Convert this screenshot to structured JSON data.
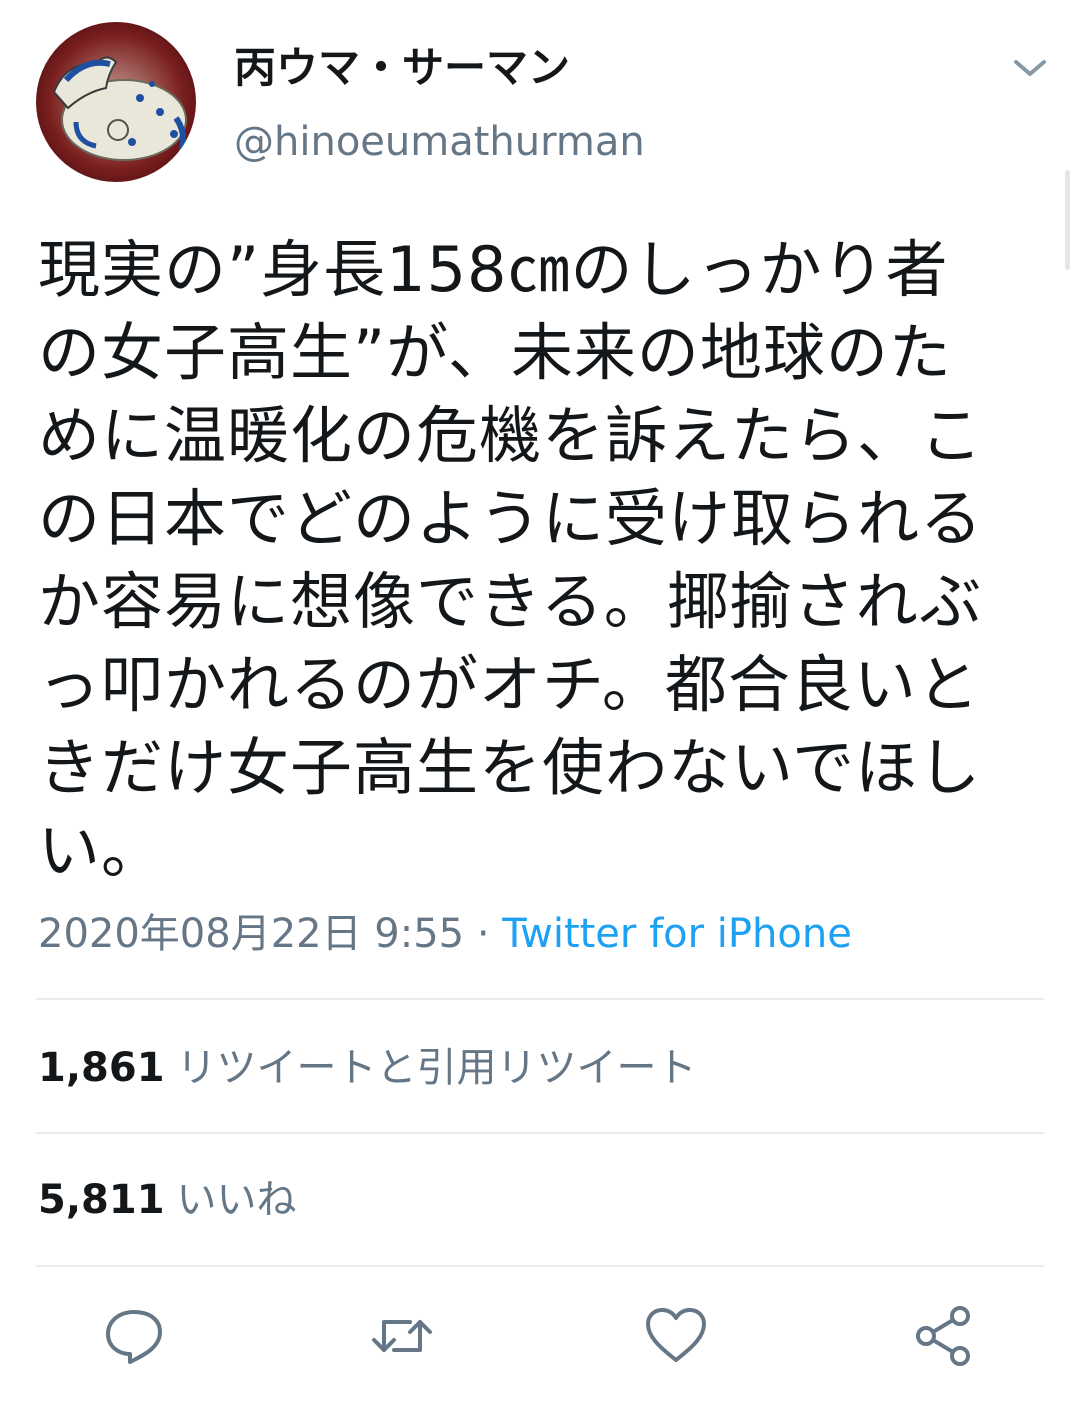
{
  "user": {
    "display_name": "丙ウマ・サーマン",
    "handle": "@hinoeumathurman",
    "avatar_icon": "horse-illustration-avatar"
  },
  "tweet": {
    "lines": [
      "現実の”身長158㎝のしっかり者",
      "の女子高生”が、未来の地球のた",
      "めに温暖化の危機を訴えたら、こ",
      "の日本でどのように受け取られる",
      "か容易に想像できる。揶揄されぶ",
      "っ叩かれるのがオチ。都合良いと",
      "きだけ女子高生を使わないでほし",
      "い。"
    ],
    "timestamp": "2020年08月22日 9:55",
    "separator": " · ",
    "source": "Twitter for iPhone"
  },
  "stats": {
    "retweets_count": "1,861",
    "retweets_label": "リツイートと引用リツイート",
    "likes_count": "5,811",
    "likes_label": "いいね"
  },
  "actions": [
    "reply-icon",
    "retweet-icon",
    "like-icon",
    "share-icon"
  ],
  "colors": {
    "text": "#14171a",
    "secondary": "#657786",
    "link": "#1da1f2",
    "divider": "#e6ecf0"
  }
}
